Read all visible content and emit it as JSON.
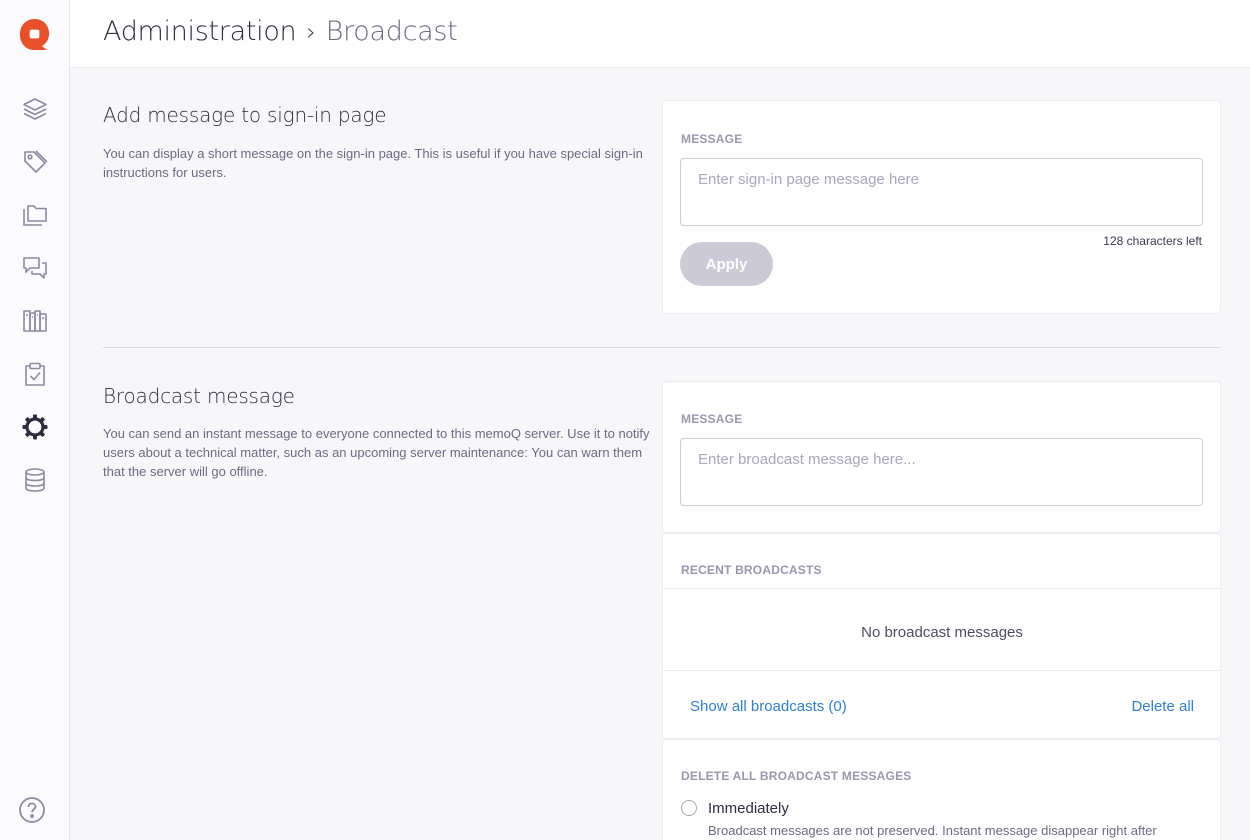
{
  "sidebar": {
    "logo": "memoq-logo",
    "items": [
      {
        "icon": "layers-icon"
      },
      {
        "icon": "tag-icon"
      },
      {
        "icon": "folders-icon"
      },
      {
        "icon": "chat-icon"
      },
      {
        "icon": "library-icon"
      },
      {
        "icon": "clipboard-check-icon"
      },
      {
        "icon": "gear-icon"
      },
      {
        "icon": "database-icon"
      }
    ],
    "help_icon": "help-icon",
    "accent_color": "#e8502a"
  },
  "header": {
    "breadcrumb_root": "Administration",
    "breadcrumb_separator": "›",
    "breadcrumb_current": "Broadcast"
  },
  "signin": {
    "title": "Add message to sign-in page",
    "description": "You can display a short message on the sign-in page. This is useful if you have special sign-in instructions for users.",
    "field_label": "MESSAGE",
    "placeholder": "Enter sign-in page message here",
    "value": "",
    "counter": "128 characters left",
    "apply_label": "Apply"
  },
  "broadcast": {
    "title": "Broadcast message",
    "description": "You can send an instant message to everyone connected to this memoQ server. Use it to notify users about a technical matter, such as an upcoming server maintenance: You can warn them that the server will go offline.",
    "field_label": "MESSAGE",
    "placeholder": "Enter broadcast message here...",
    "value": "",
    "recent_label": "RECENT BROADCASTS",
    "empty_text": "No broadcast messages",
    "show_all": "Show all broadcasts (0)",
    "delete_all": "Delete all",
    "delete_section_label": "DELETE ALL BROADCAST MESSAGES",
    "option_immediately": "Immediately",
    "option_immediately_desc": "Broadcast messages are not preserved. Instant message disappear right after"
  }
}
